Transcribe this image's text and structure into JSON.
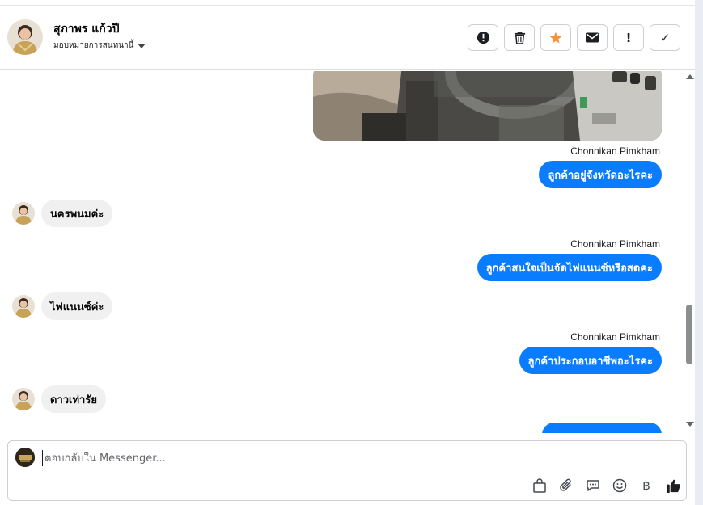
{
  "header": {
    "name": "สุภาพร แก้วปี",
    "assign_label": "มอบหมายการสนทนานี้",
    "actions": [
      {
        "icon": "alert-circle-icon"
      },
      {
        "icon": "trash-icon"
      },
      {
        "icon": "star-icon",
        "color": "#f7923a"
      },
      {
        "icon": "envelope-icon"
      },
      {
        "icon": "exclamation-icon",
        "glyph": "!"
      },
      {
        "icon": "checkmark-icon",
        "glyph": "✓"
      }
    ]
  },
  "conversation": {
    "messages": [
      {
        "direction": "out",
        "sender": "Chonnikan Pimkham",
        "text": "ลูกค้าอยู่จังหวัดอะไรคะ"
      },
      {
        "direction": "in",
        "text": "นครพนมค่ะ"
      },
      {
        "direction": "out",
        "sender": "Chonnikan Pimkham",
        "text": "ลูกค้าสนใจเป็นจัดไฟแนนซ์หรือสดคะ"
      },
      {
        "direction": "in",
        "text": "ไฟแนนซ์ค่ะ"
      },
      {
        "direction": "out",
        "sender": "Chonnikan Pimkham",
        "text": "ลูกค้าประกอบอาชีพอะไรคะ"
      },
      {
        "direction": "in",
        "text": "ดาวเท่ารัย"
      }
    ]
  },
  "composer": {
    "placeholder": "ตอบกลับใน Messenger...",
    "tools": [
      "shopping-bag-icon",
      "paperclip-icon",
      "saved-reply-icon",
      "emoji-icon",
      "baht-icon",
      "thumbs-up-icon"
    ]
  },
  "colors": {
    "outgoing_bubble": "#0a7cff",
    "incoming_bubble": "#f0f0f0",
    "star": "#f7923a"
  }
}
